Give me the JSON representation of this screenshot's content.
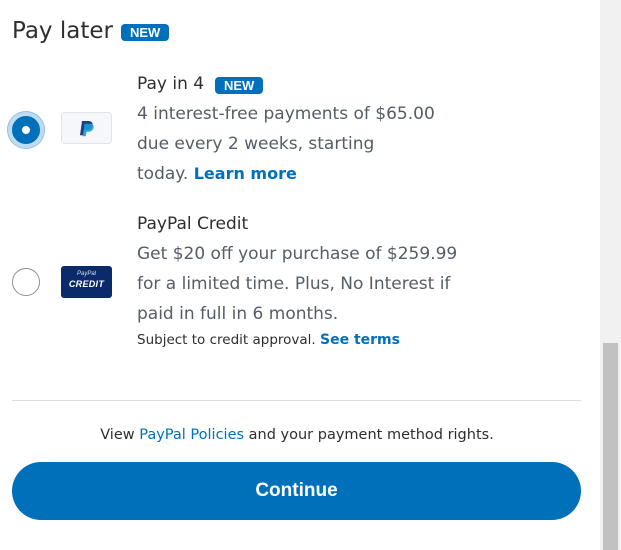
{
  "section": {
    "title": "Pay later",
    "badge": "NEW"
  },
  "options": [
    {
      "title": "Pay in 4",
      "badge": "NEW",
      "selected": true,
      "icon": "paypal-logo-icon",
      "desc_line1": "4 interest-free payments of $65.00",
      "desc_line2": "due every 2 weeks, starting",
      "desc_line3": "today.",
      "link": "Learn more"
    },
    {
      "title": "PayPal Credit",
      "selected": false,
      "icon": "paypal-credit-icon",
      "icon_text_top": "PayPal",
      "icon_text_main": "CREDIT",
      "desc_line1": "Get $20 off your purchase of $259.99",
      "desc_line2": "for a limited time. Plus, No Interest if",
      "desc_line3": "paid in full in 6 months.",
      "fine_print": "Subject to credit approval.",
      "link": "See terms"
    }
  ],
  "footer": {
    "policies_prefix": "View",
    "policies_link": "PayPal Policies",
    "policies_suffix": "and your payment method rights.",
    "continue_label": "Continue"
  },
  "colors": {
    "accent": "#0070ba",
    "credit_navy": "#0b2a6b"
  }
}
